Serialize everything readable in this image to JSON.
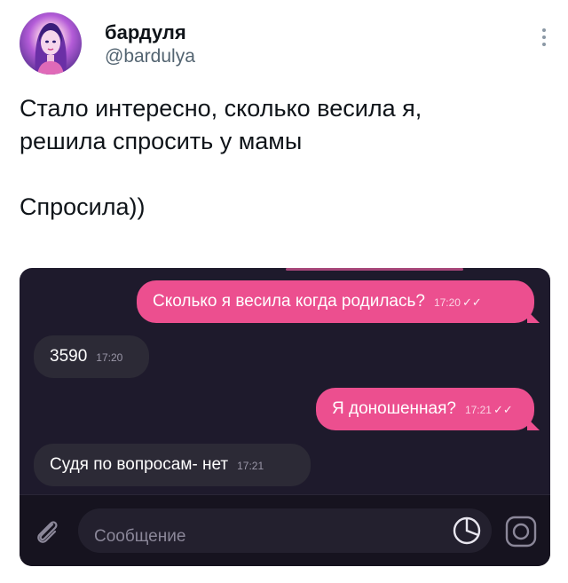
{
  "author": {
    "name": "бардуля",
    "handle": "@bardulya",
    "avatar_icon": "avatar-image"
  },
  "tweet": {
    "line1": "Стало интересно, сколько весила я,",
    "line2": "решила спросить у мамы",
    "line3": "Спросила))"
  },
  "chat": {
    "messages": [
      {
        "text": "Сколько я весила когда родилась?",
        "time": "17:20",
        "direction": "out",
        "status_icon": "double-check-icon"
      },
      {
        "text": "3590",
        "time": "17:20",
        "direction": "in"
      },
      {
        "text": "Я доношенная?",
        "time": "17:21",
        "direction": "out",
        "status_icon": "double-check-icon"
      },
      {
        "text": "Судя по вопросам- нет",
        "time": "17:21",
        "direction": "in"
      }
    ],
    "composer": {
      "placeholder": "Сообщение",
      "left_icon": "paperclip-icon",
      "sticker_icon": "sticker-icon",
      "camera_icon": "camera-icon"
    },
    "colors": {
      "outgoing": "#ec4f8f",
      "incoming": "#2c2a36",
      "background": "#1e1a2c"
    }
  }
}
